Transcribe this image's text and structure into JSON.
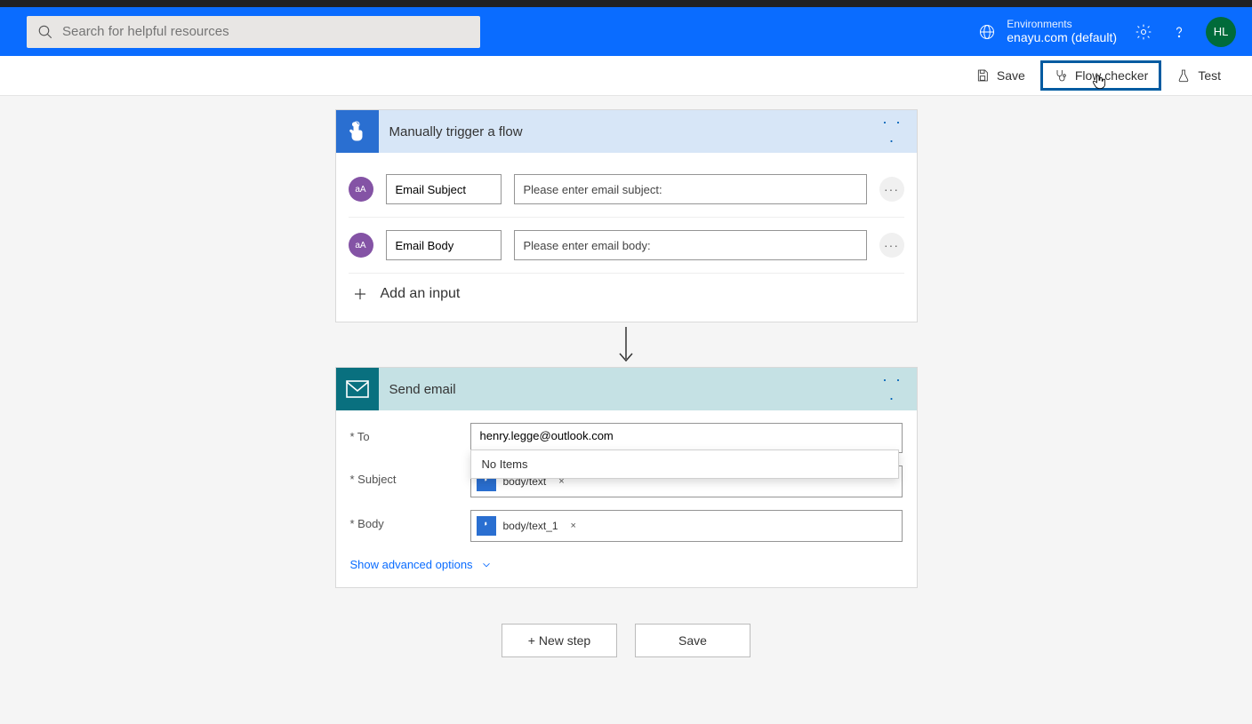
{
  "topbar": {
    "search_placeholder": "Search for helpful resources",
    "env_label": "Environments",
    "env_name": "enayu.com (default)",
    "avatar_initials": "HL"
  },
  "toolbar": {
    "save": "Save",
    "flow_checker": "Flow checker",
    "test": "Test"
  },
  "trigger_card": {
    "title": "Manually trigger a flow",
    "type_badge": "aA",
    "rows": [
      {
        "name": "Email Subject",
        "hint": "Please enter email subject:"
      },
      {
        "name": "Email Body",
        "hint": "Please enter email body:"
      }
    ],
    "add_input_label": "Add an input"
  },
  "send_card": {
    "title": "Send email",
    "labels": {
      "to": "* To",
      "subject": "* Subject",
      "body": "* Body"
    },
    "to_value": "henry.legge@outlook.com",
    "autocomplete_msg": "No Items",
    "subject_token": "body/text",
    "body_token": "body/text_1",
    "token_close": "×",
    "advanced_label": "Show advanced options"
  },
  "bottom": {
    "new_step": "+ New step",
    "save": "Save"
  }
}
